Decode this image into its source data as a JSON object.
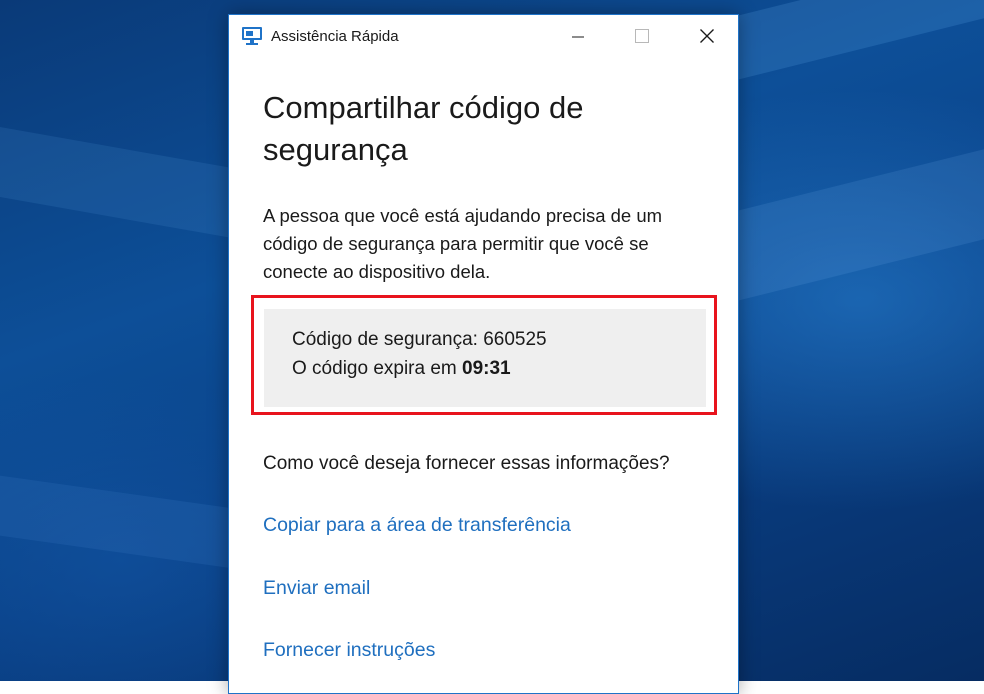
{
  "window": {
    "title": "Assistência Rápida",
    "app_icon": "remote-desktop-monitor-icon",
    "controls": {
      "minimize_icon": "minimize-icon",
      "maximize_icon": "maximize-icon",
      "close_icon": "close-icon"
    }
  },
  "main": {
    "heading": "Compartilhar código de segurança",
    "description": "A pessoa que você está ajudando precisa de um código de segurança para permitir que você se conecte ao dispositivo dela.",
    "code_box": {
      "code_label": "Código de segurança: 660525",
      "expire_label": "O código expira em",
      "expire_time": "09:31",
      "highlight_color": "#e8131d",
      "panel_color": "#efefef"
    },
    "question": "Como você deseja fornecer essas informações?",
    "options": [
      {
        "label": "Copiar para a área de transferência"
      },
      {
        "label": "Enviar email"
      },
      {
        "label": "Fornecer instruções"
      }
    ],
    "link_color": "#1f6fbf"
  },
  "desktop": {
    "accent": "#0d4f98"
  }
}
